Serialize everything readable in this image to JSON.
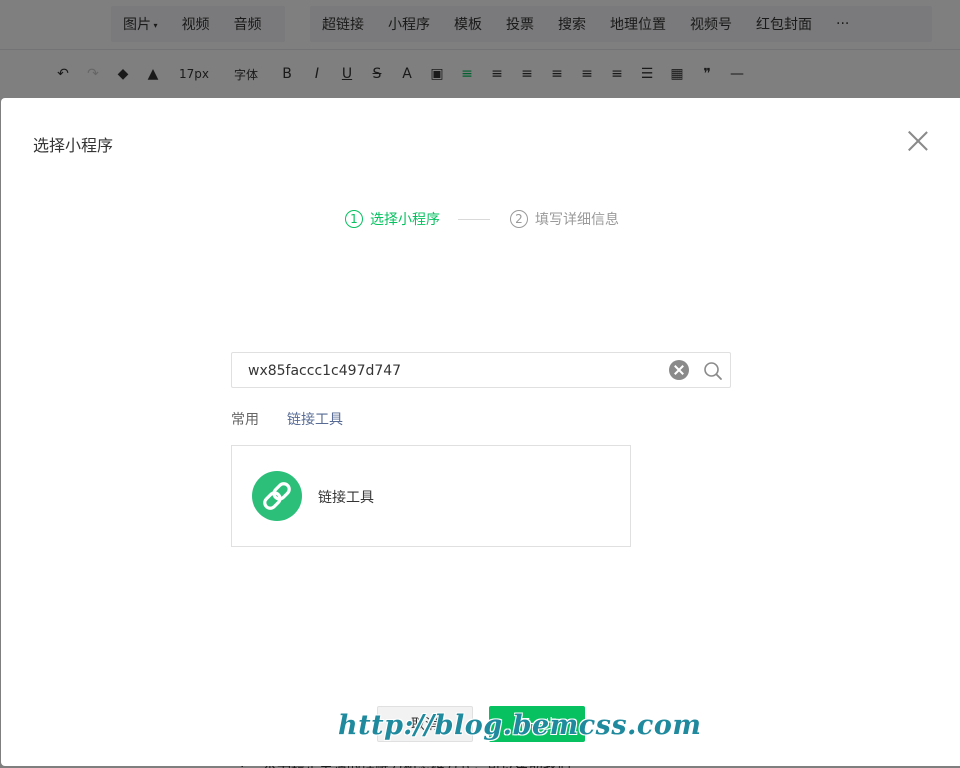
{
  "editor": {
    "insert_group_1": [
      "图片",
      "视频",
      "音频"
    ],
    "insert_group_2": [
      "超链接",
      "小程序",
      "模板",
      "投票",
      "搜索",
      "地理位置",
      "视频号",
      "红包封面",
      "···"
    ],
    "format_font_size": "17px",
    "format_font_family": "字体",
    "format_buttons": [
      "B",
      "I",
      "U",
      "S",
      "A"
    ],
    "bottom_text": "· 一本书籍是生活的理解力和思维方式，可以帮助我们"
  },
  "dialog": {
    "title": "选择小程序",
    "steps": [
      {
        "num": "1",
        "label": "选择小程序",
        "state": "active"
      },
      {
        "num": "2",
        "label": "填写详细信息",
        "state": "inactive"
      }
    ],
    "search": {
      "value": "wx85faccc1c497d747",
      "placeholder": ""
    },
    "tabs": [
      {
        "label": "常用",
        "selected": false
      },
      {
        "label": "链接工具",
        "selected": true
      }
    ],
    "result": {
      "name": "链接工具",
      "icon": "link-icon"
    },
    "buttons": {
      "cancel": "取消",
      "next": "下一步"
    }
  },
  "watermark": "http://blog.bemcss.com",
  "colors": {
    "accent": "#07c160",
    "link": "#576b95",
    "logo_bg": "#2bbf7a",
    "watermark": "#1f8a9e"
  }
}
